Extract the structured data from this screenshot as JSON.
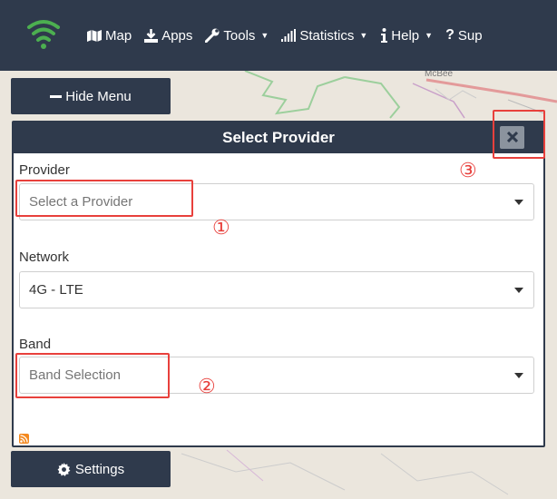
{
  "navbar": {
    "items": [
      {
        "label": "Map",
        "icon": "map-icon",
        "has_caret": false
      },
      {
        "label": "Apps",
        "icon": "download-icon",
        "has_caret": false
      },
      {
        "label": "Tools",
        "icon": "wrench-icon",
        "has_caret": true
      },
      {
        "label": "Statistics",
        "icon": "signal-bars-icon",
        "has_caret": true
      },
      {
        "label": "Help",
        "icon": "info-icon",
        "has_caret": true
      },
      {
        "label": "Sup",
        "icon": "question-icon",
        "has_caret": false
      }
    ],
    "logo_icon": "wifi-signal-icon",
    "logo_color": "#4caf50"
  },
  "sidebar": {
    "hide_menu_label": "Hide Menu",
    "settings_label": "Settings"
  },
  "map": {
    "town_label": "McBee"
  },
  "modal": {
    "title": "Select Provider",
    "close_icon": "close-icon",
    "provider": {
      "label": "Provider",
      "placeholder": "Select a Provider"
    },
    "network": {
      "label": "Network",
      "value": "4G - LTE"
    },
    "band": {
      "label": "Band",
      "placeholder": "Band Selection"
    }
  },
  "annotations": {
    "one": "①",
    "two": "②",
    "three": "③"
  },
  "colors": {
    "navbar": "#2f3a4c",
    "annotation": "#e8403c",
    "rss": "#f4891f"
  }
}
